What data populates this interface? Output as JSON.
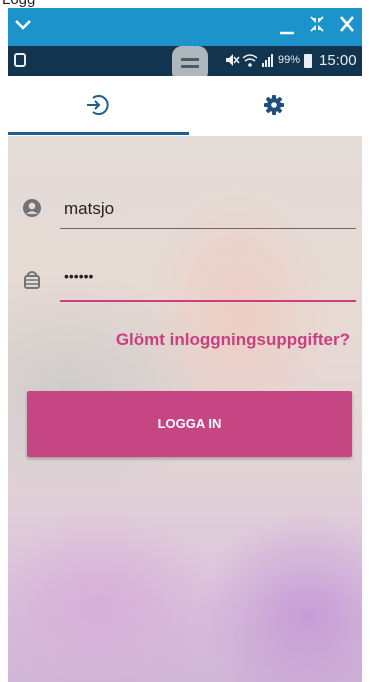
{
  "window": {
    "title": "Logg",
    "collapse_icon": "chevron-down-icon",
    "minimize_icon": "minimize-icon",
    "shrink_icon": "shrink-icon",
    "close_icon": "close-icon"
  },
  "status_bar": {
    "battery_percent": "99%",
    "time": "15:00",
    "icons": [
      "sync-icon",
      "upload-icon",
      "mute-icon",
      "wifi-icon",
      "signal-icon",
      "battery-icon"
    ]
  },
  "tabs": [
    {
      "name": "login",
      "icon": "login-icon",
      "selected": true
    },
    {
      "name": "settings",
      "icon": "gear-icon",
      "selected": false
    }
  ],
  "form": {
    "username": {
      "value": "matsjo",
      "icon": "user-icon"
    },
    "password": {
      "value": "••••••",
      "icon": "lock-icon"
    },
    "forgot_link": "Glömt inloggningsuppgifter?",
    "login_button": "LOGGA IN"
  },
  "colors": {
    "title_bar": "#1c94cb",
    "status_bar": "#12344f",
    "accent": "#c54682",
    "tab_indicator": "#1f5f8e"
  }
}
